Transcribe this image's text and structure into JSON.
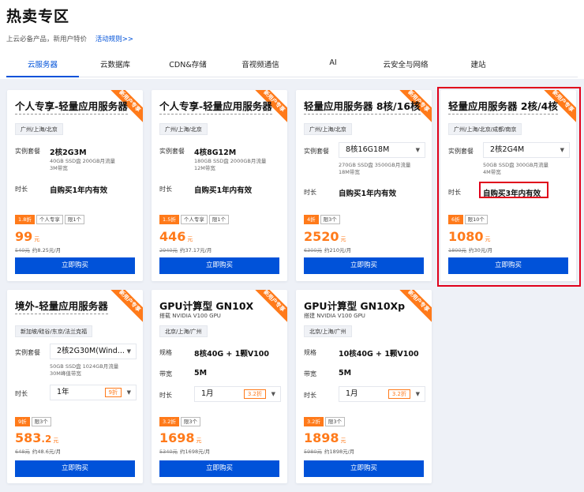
{
  "header": {
    "title": "热卖专区",
    "subtitle": "上云必备产品，新用户特价",
    "rules_link": "活动规则>>"
  },
  "tabs": [
    "云服务器",
    "云数据库",
    "CDN&存储",
    "音视频通信",
    "AI",
    "云安全与网络",
    "建站"
  ],
  "common": {
    "ribbon": "新用户专享",
    "plan_label": "实例套餐",
    "duration_label": "时长",
    "spec_label": "规格",
    "bandwidth_label": "带宽",
    "buy_label": "立即购买",
    "currency_unit": "元"
  },
  "cards": [
    {
      "title": "个人专享-轻量应用服务器",
      "region": "广州/上海/北京",
      "plan": "2核2G3M",
      "plan_desc": "40GB SSD盘 200GB月流量\n3M带宽",
      "duration": "自购买1年内有效",
      "badges": [
        "1.8折",
        "个人专享",
        "限1个"
      ],
      "price": "99",
      "orig_price": "540元",
      "monthly": "约8.25元/月"
    },
    {
      "title": "个人专享-轻量应用服务器",
      "region": "广州/上海/北京",
      "plan": "4核8G12M",
      "plan_desc": "180GB SSD盘 2000GB月流量\n12M带宽",
      "duration": "自购买1年内有效",
      "badges": [
        "1.5折",
        "个人专享",
        "限1个"
      ],
      "price": "446",
      "orig_price": "2940元",
      "monthly": "约37.17元/月"
    },
    {
      "title": "轻量应用服务器 8核/16核",
      "region": "广州/上海/北京",
      "plan": "8核16G18M",
      "plan_desc": "270GB SSD盘 3500GB月流量\n18M带宽",
      "duration": "自购买1年内有效",
      "badges": [
        "4折",
        "限3个"
      ],
      "price": "2520",
      "orig_price": "6300元",
      "monthly": "约210元/月"
    },
    {
      "title": "轻量应用服务器 2核/4核",
      "region": "广州/上海/北京/成都/南京",
      "plan": "2核2G4M",
      "plan_desc": "50GB SSD盘 300GB月流量\n4M带宽",
      "duration": "自购买3年内有效",
      "badges": [
        "6折",
        "限10个"
      ],
      "price": "1080",
      "orig_price": "1800元",
      "monthly": "约30元/月"
    },
    {
      "title": "境外-轻量应用服务器",
      "region": "新加坡/硅谷/东京/法兰克福",
      "plan": "2核2G30M(Wind...",
      "plan_desc": "50GB SSD盘 1024GB月流量\n30M峰值带宽",
      "duration": "1年",
      "duration_discount": "9折",
      "badges": [
        "9折",
        "限3个"
      ],
      "price": "583",
      "price_dec": ".2",
      "orig_price": "648元",
      "monthly": "约48.6元/月"
    },
    {
      "title": "GPU计算型 GN10X",
      "subtitle": "搭载 NVIDIA V100 GPU",
      "region": "北京/上海/广州",
      "spec": "8核40G + 1颗V100",
      "bandwidth": "5M",
      "duration": "1月",
      "duration_discount": "3.2折",
      "badges": [
        "3.2折",
        "限3个"
      ],
      "price": "1698",
      "orig_price": "5340元",
      "monthly": "约1698元/月"
    },
    {
      "title": "GPU计算型 GN10Xp",
      "subtitle": "搭建 NVIDIA V100 GPU",
      "region": "北京/上海/广州",
      "spec": "10核40G + 1颗V100",
      "bandwidth": "5M",
      "duration": "1月",
      "duration_discount": "3.2折",
      "badges": [
        "3.2折",
        "限3个"
      ],
      "price": "1898",
      "orig_price": "5980元",
      "monthly": "约1898元/月"
    }
  ],
  "colors": {
    "accent": "#0052d9",
    "promo": "#ff7a1a",
    "highlight": "#e0001b"
  }
}
